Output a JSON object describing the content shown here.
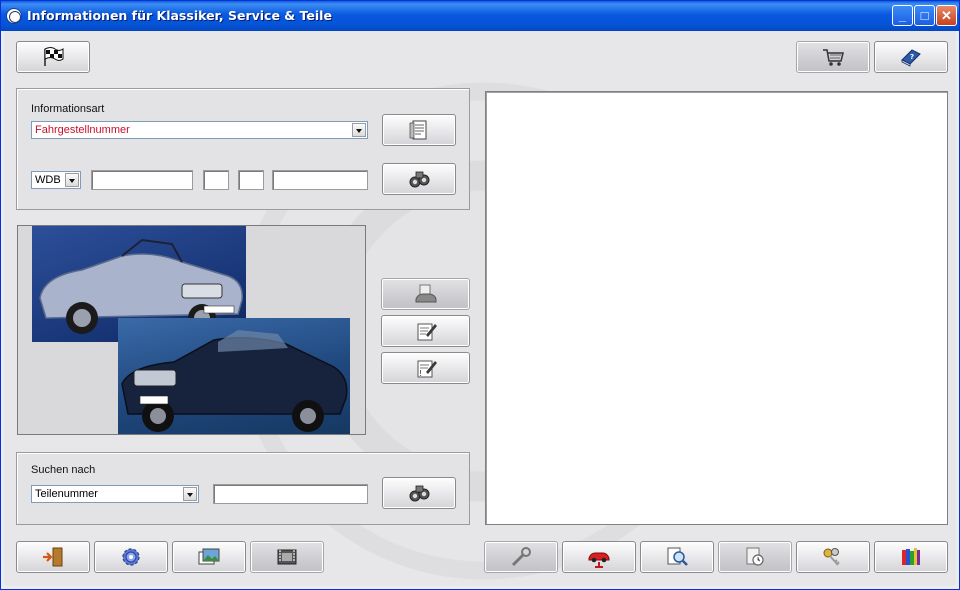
{
  "window": {
    "title": "Informationen für Klassiker, Service & Teile"
  },
  "info_panel": {
    "label": "Informationsart",
    "type_select": {
      "value": "Fahrgestellnummer",
      "color": "#c8102e"
    },
    "prefix_select": {
      "value": "WDB"
    },
    "fields": [
      "",
      "",
      "",
      ""
    ]
  },
  "search_panel": {
    "label": "Suchen nach",
    "type_select": {
      "value": "Teilenummer"
    },
    "search_value": ""
  },
  "icons": {
    "start": "checkered-flag-icon",
    "cart": "shopping-cart-icon",
    "help": "help-book-icon",
    "document": "document-list-icon",
    "search": "binoculars-icon",
    "car_doc": "car-document-icon",
    "edit": "edit-document-icon",
    "edit_remove": "edit-document-remove-icon",
    "exit": "exit-door-icon",
    "settings": "gear-icon",
    "images": "images-icon",
    "film": "film-icon",
    "tools": "wrench-icon",
    "lift": "car-lift-icon",
    "lookup": "document-magnifier-icon",
    "history": "clock-document-icon",
    "keys": "keys-icon",
    "library": "books-icon"
  }
}
